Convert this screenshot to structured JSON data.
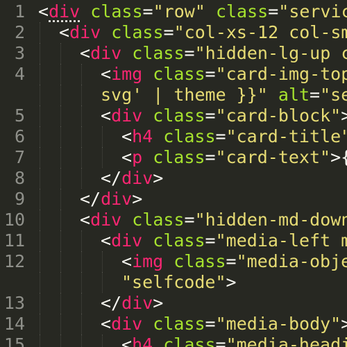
{
  "colors": {
    "background": "#272822",
    "line_number": "#8f908a",
    "punctuation": "#f8f8f2",
    "tag": "#f92672",
    "attribute": "#a6e22e",
    "string": "#e6db74"
  },
  "lines": [
    {
      "n": "1",
      "indent": 0,
      "tokens": [
        [
          "punct",
          "<"
        ],
        [
          "tag",
          "div"
        ],
        [
          "punct",
          " "
        ],
        [
          "attr",
          "class"
        ],
        [
          "punct",
          "="
        ],
        [
          "str",
          "\"row\""
        ],
        [
          "punct",
          " "
        ],
        [
          "attr",
          "class"
        ],
        [
          "punct",
          "="
        ],
        [
          "str",
          "\"servic"
        ]
      ]
    },
    {
      "n": "2",
      "indent": 1,
      "tokens": [
        [
          "punct",
          "<"
        ],
        [
          "tag",
          "div"
        ],
        [
          "punct",
          " "
        ],
        [
          "attr",
          "class"
        ],
        [
          "punct",
          "="
        ],
        [
          "str",
          "\"col-xs-12 col-sm"
        ]
      ]
    },
    {
      "n": "3",
      "indent": 2,
      "tokens": [
        [
          "punct",
          "<"
        ],
        [
          "tag",
          "div"
        ],
        [
          "punct",
          " "
        ],
        [
          "attr",
          "class"
        ],
        [
          "punct",
          "="
        ],
        [
          "str",
          "\"hidden-lg-up c"
        ]
      ]
    },
    {
      "n": "4",
      "indent": 3,
      "tokens": [
        [
          "punct",
          "<"
        ],
        [
          "tag",
          "img"
        ],
        [
          "punct",
          " "
        ],
        [
          "attr",
          "class"
        ],
        [
          "punct",
          "="
        ],
        [
          "str",
          "\"card-img-top"
        ]
      ]
    },
    {
      "n": "",
      "indent": 3,
      "tokens": [
        [
          "str",
          "svg' | theme }}\""
        ],
        [
          "punct",
          " "
        ],
        [
          "attr",
          "alt"
        ],
        [
          "punct",
          "="
        ],
        [
          "str",
          "\"se"
        ]
      ]
    },
    {
      "n": "5",
      "indent": 3,
      "tokens": [
        [
          "punct",
          "<"
        ],
        [
          "tag",
          "div"
        ],
        [
          "punct",
          " "
        ],
        [
          "attr",
          "class"
        ],
        [
          "punct",
          "="
        ],
        [
          "str",
          "\"card-block\""
        ],
        [
          "punct",
          ">"
        ]
      ]
    },
    {
      "n": "6",
      "indent": 4,
      "tokens": [
        [
          "punct",
          "<"
        ],
        [
          "tag",
          "h4"
        ],
        [
          "punct",
          " "
        ],
        [
          "attr",
          "class"
        ],
        [
          "punct",
          "="
        ],
        [
          "str",
          "\"card-title\""
        ]
      ]
    },
    {
      "n": "7",
      "indent": 4,
      "tokens": [
        [
          "punct",
          "<"
        ],
        [
          "tag",
          "p"
        ],
        [
          "punct",
          " "
        ],
        [
          "attr",
          "class"
        ],
        [
          "punct",
          "="
        ],
        [
          "str",
          "\"card-text\""
        ],
        [
          "punct",
          ">{"
        ]
      ]
    },
    {
      "n": "8",
      "indent": 3,
      "tokens": [
        [
          "punct",
          "</"
        ],
        [
          "tag",
          "div"
        ],
        [
          "punct",
          ">"
        ]
      ]
    },
    {
      "n": "9",
      "indent": 2,
      "tokens": [
        [
          "punct",
          "</"
        ],
        [
          "tag",
          "div"
        ],
        [
          "punct",
          ">"
        ]
      ]
    },
    {
      "n": "10",
      "indent": 2,
      "tokens": [
        [
          "punct",
          "<"
        ],
        [
          "tag",
          "div"
        ],
        [
          "punct",
          " "
        ],
        [
          "attr",
          "class"
        ],
        [
          "punct",
          "="
        ],
        [
          "str",
          "\"hidden-md-down"
        ]
      ]
    },
    {
      "n": "11",
      "indent": 3,
      "tokens": [
        [
          "punct",
          "<"
        ],
        [
          "tag",
          "div"
        ],
        [
          "punct",
          " "
        ],
        [
          "attr",
          "class"
        ],
        [
          "punct",
          "="
        ],
        [
          "str",
          "\"media-left m"
        ]
      ]
    },
    {
      "n": "12",
      "indent": 4,
      "tokens": [
        [
          "punct",
          "<"
        ],
        [
          "tag",
          "img"
        ],
        [
          "punct",
          " "
        ],
        [
          "attr",
          "class"
        ],
        [
          "punct",
          "="
        ],
        [
          "str",
          "\"media-obje"
        ]
      ]
    },
    {
      "n": "",
      "indent": 4,
      "tokens": [
        [
          "str",
          "\"selfcode\""
        ],
        [
          "punct",
          ">"
        ]
      ]
    },
    {
      "n": "13",
      "indent": 3,
      "tokens": [
        [
          "punct",
          "</"
        ],
        [
          "tag",
          "div"
        ],
        [
          "punct",
          ">"
        ]
      ]
    },
    {
      "n": "14",
      "indent": 3,
      "tokens": [
        [
          "punct",
          "<"
        ],
        [
          "tag",
          "div"
        ],
        [
          "punct",
          " "
        ],
        [
          "attr",
          "class"
        ],
        [
          "punct",
          "="
        ],
        [
          "str",
          "\"media-body\""
        ],
        [
          "punct",
          ">"
        ]
      ]
    },
    {
      "n": "15",
      "indent": 4,
      "tokens": [
        [
          "punct",
          "<"
        ],
        [
          "tag",
          "h4"
        ],
        [
          "punct",
          " "
        ],
        [
          "attr",
          "class"
        ],
        [
          "punct",
          "="
        ],
        [
          "str",
          "\"media-headi"
        ]
      ]
    }
  ]
}
